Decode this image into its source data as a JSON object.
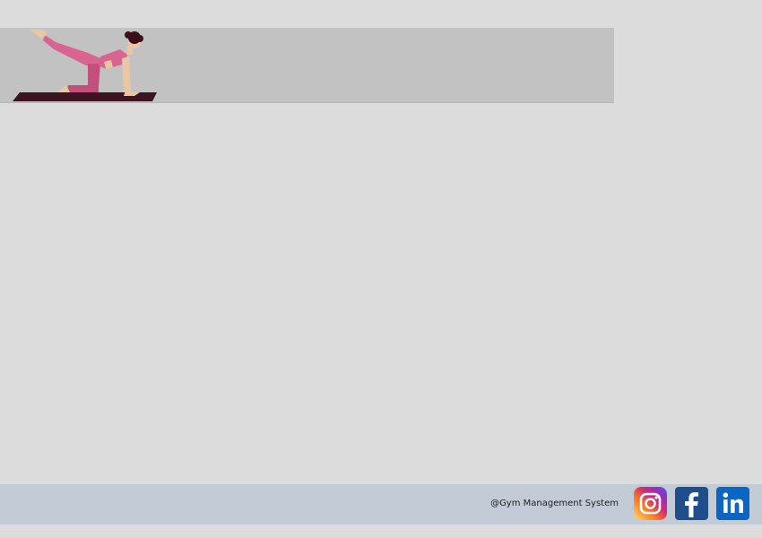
{
  "banner": {
    "illustration": "woman-yoga-pose-icon",
    "colors": {
      "background": "#c2c2c2",
      "outfit": "#d9648f",
      "skin": "#e9c6a6",
      "hair": "#3b0f18",
      "mat": "#3c1422"
    }
  },
  "footer": {
    "copyright": "@Gym Management System",
    "background": "#c3ccd6",
    "social": [
      {
        "name": "instagram-icon",
        "color": "#c13584"
      },
      {
        "name": "facebook-icon",
        "color": "#1f4e8c"
      },
      {
        "name": "linkedin-icon",
        "color": "#0a66c2"
      }
    ]
  }
}
